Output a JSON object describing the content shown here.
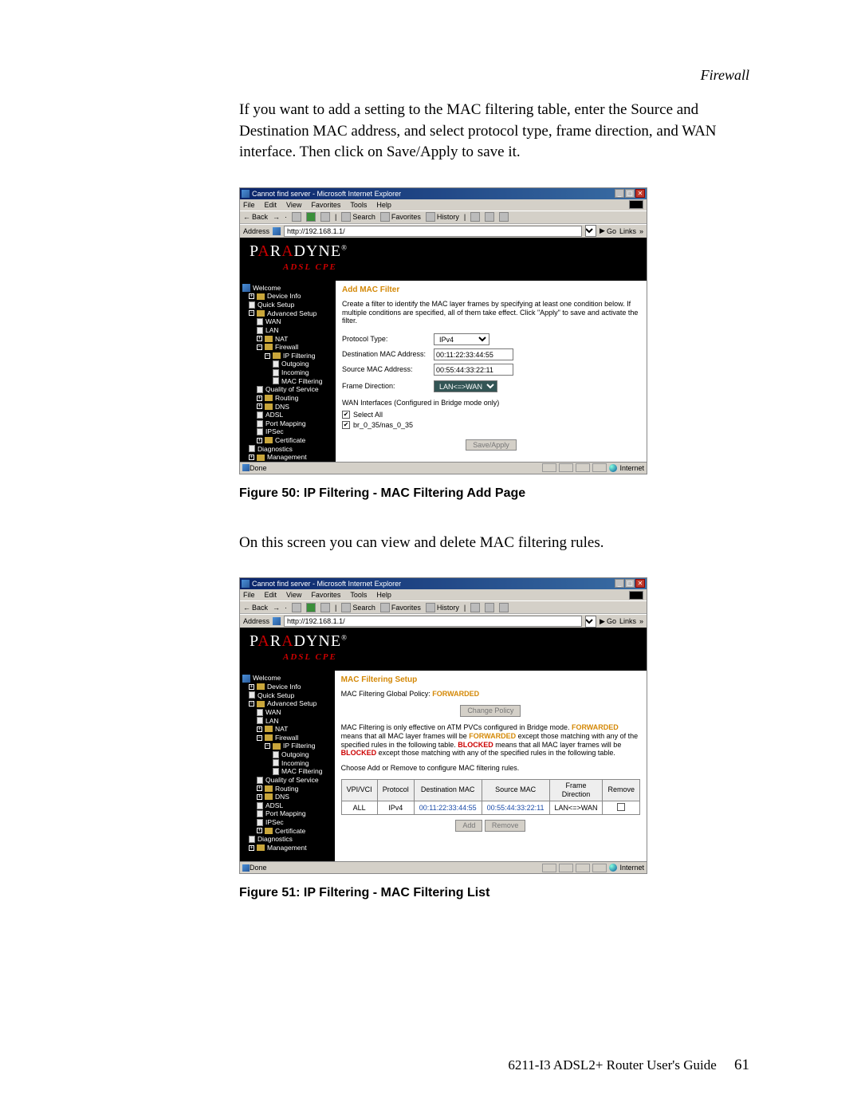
{
  "section_label": "Firewall",
  "paragraphs": {
    "intro": "If you want to add a setting to the MAC filtering table, enter the Source and Destination MAC address, and select protocol type, frame direction, and WAN interface. Then click on Save/Apply to save it.",
    "second": "On this screen you can view and delete MAC filtering rules."
  },
  "captions": {
    "fig50": "Figure 50: IP Filtering - MAC Filtering Add Page",
    "fig51": "Figure 51: IP Filtering - MAC Filtering List"
  },
  "footer": {
    "guide": "6211-I3 ADSL2+ Router User's Guide",
    "page": "61"
  },
  "browser": {
    "title": "Cannot find server - Microsoft Internet Explorer",
    "menu": [
      "File",
      "Edit",
      "View",
      "Favorites",
      "Tools",
      "Help"
    ],
    "toolbar": {
      "back": "Back",
      "search": "Search",
      "favorites": "Favorites",
      "history": "History"
    },
    "address_label": "Address",
    "address_value": "http://192.168.1.1/",
    "go": "Go",
    "links": "Links",
    "status_done": "Done",
    "status_internet": "Internet"
  },
  "brand": {
    "name": "PARADYNE",
    "sub": "ADSL CPE"
  },
  "sidebar": {
    "welcome": "Welcome",
    "items": [
      "Device Info",
      "Quick Setup",
      "Advanced Setup",
      "WAN",
      "LAN",
      "NAT",
      "Firewall",
      "IP Filtering",
      "Outgoing",
      "Incoming",
      "MAC Filtering",
      "Quality of Service",
      "Routing",
      "DNS",
      "ADSL",
      "Port Mapping",
      "IPSec",
      "Certificate",
      "Diagnostics",
      "Management"
    ]
  },
  "add_page": {
    "title": "Add MAC Filter",
    "desc": "Create a filter to identify the MAC layer frames by specifying at least one condition below. If multiple conditions are specified, all of them take effect. Click \"Apply\" to save and activate the filter.",
    "fields": {
      "protocol": "Protocol Type:",
      "protocol_value": "IPv4",
      "dest": "Destination MAC Address:",
      "dest_value": "00:11:22:33:44:55",
      "src": "Source MAC Address:",
      "src_value": "00:55:44:33:22:11",
      "direction": "Frame Direction:",
      "direction_value": "LAN<=>WAN",
      "wan_label": "WAN Interfaces (Configured in Bridge mode only)",
      "select_all": "Select All",
      "br_if": "br_0_35/nas_0_35"
    },
    "save": "Save/Apply"
  },
  "list_page": {
    "title": "MAC Filtering Setup",
    "policy_text": "MAC Filtering Global Policy:",
    "policy_value": "FORWARDED",
    "change_btn": "Change Policy",
    "desc_pre": "MAC Filtering is only effective on ATM PVCs configured in Bridge mode. ",
    "forwarded": "FORWARDED",
    "desc_mid1": " means that all MAC layer frames will be ",
    "desc_mid2": " except those matching with any of the specified rules in the following table. ",
    "blocked": "BLOCKED",
    "desc_mid3": " means that all MAC layer frames will be ",
    "desc_mid4": " except those matching with any of the specified rules in the following table.",
    "choose": "Choose Add or Remove to configure MAC filtering rules.",
    "table": {
      "headers": [
        "VPI/VCI",
        "Protocol",
        "Destination MAC",
        "Source MAC",
        "Frame Direction",
        "Remove"
      ],
      "row": [
        "ALL",
        "IPv4",
        "00:11:22:33:44:55",
        "00:55:44:33:22:11",
        "LAN<=>WAN",
        ""
      ]
    },
    "add_btn": "Add",
    "remove_btn": "Remove"
  }
}
